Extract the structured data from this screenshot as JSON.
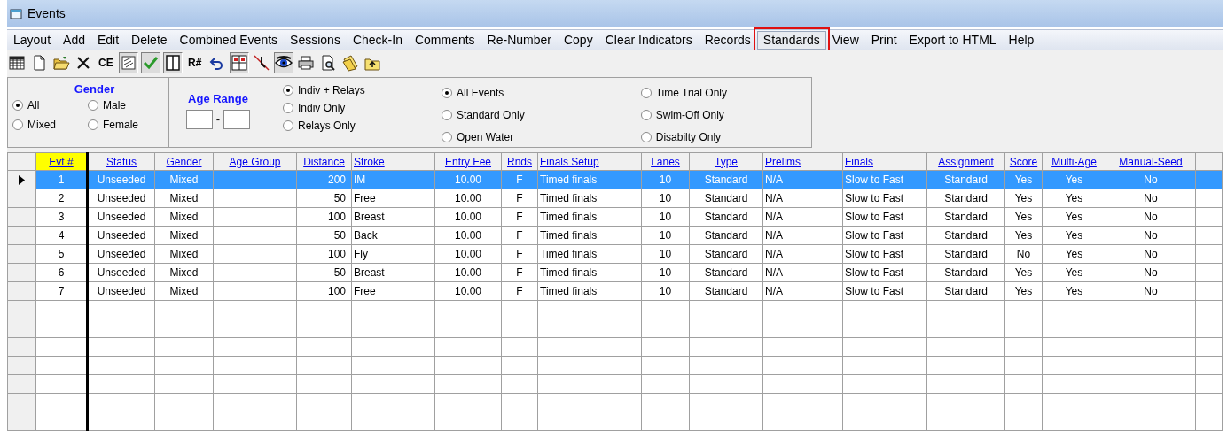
{
  "window": {
    "title": "Events"
  },
  "menu": [
    {
      "label": "Layout",
      "highlighted": false
    },
    {
      "label": "Add",
      "highlighted": false
    },
    {
      "label": "Edit",
      "highlighted": false
    },
    {
      "label": "Delete",
      "highlighted": false
    },
    {
      "label": "Combined Events",
      "highlighted": false
    },
    {
      "label": "Sessions",
      "highlighted": false
    },
    {
      "label": "Check-In",
      "highlighted": false
    },
    {
      "label": "Comments",
      "highlighted": false
    },
    {
      "label": "Re-Number",
      "highlighted": false
    },
    {
      "label": "Copy",
      "highlighted": false
    },
    {
      "label": "Clear Indicators",
      "highlighted": false
    },
    {
      "label": "Records",
      "highlighted": false
    },
    {
      "label": "Standards",
      "highlighted": true
    },
    {
      "label": "View",
      "highlighted": false
    },
    {
      "label": "Print",
      "highlighted": false
    },
    {
      "label": "Export to HTML",
      "highlighted": false
    },
    {
      "label": "Help",
      "highlighted": false
    }
  ],
  "toolbar": [
    {
      "kind": "icon",
      "pressed": false
    },
    {
      "kind": "icon",
      "pressed": false
    },
    {
      "kind": "icon",
      "pressed": false
    },
    {
      "kind": "icon",
      "pressed": false
    },
    {
      "kind": "text",
      "label": "CE",
      "pressed": false
    },
    {
      "kind": "icon",
      "pressed": true
    },
    {
      "kind": "icon",
      "pressed": true
    },
    {
      "kind": "icon",
      "pressed": true
    },
    {
      "kind": "text",
      "label": "R#",
      "pressed": false
    },
    {
      "kind": "icon",
      "pressed": false
    },
    {
      "kind": "icon",
      "pressed": true
    },
    {
      "kind": "icon",
      "pressed": false
    },
    {
      "kind": "icon",
      "pressed": true
    },
    {
      "kind": "icon",
      "pressed": false
    },
    {
      "kind": "icon",
      "pressed": false
    },
    {
      "kind": "icon",
      "pressed": false
    },
    {
      "kind": "icon",
      "pressed": false
    }
  ],
  "gender_filter": {
    "title": "Gender",
    "options": [
      {
        "label": "All",
        "selected": true
      },
      {
        "label": "Male",
        "selected": false
      },
      {
        "label": "Mixed",
        "selected": false
      },
      {
        "label": "Female",
        "selected": false
      }
    ]
  },
  "age_range": {
    "title": "Age Range",
    "separator": "-"
  },
  "entry_filter": {
    "options": [
      {
        "label": "Indiv + Relays",
        "selected": true
      },
      {
        "label": "Indiv Only",
        "selected": false
      },
      {
        "label": "Relays Only",
        "selected": false
      }
    ]
  },
  "event_filter": {
    "options": [
      {
        "label": "All Events",
        "selected": true
      },
      {
        "label": "Standard Only",
        "selected": false
      },
      {
        "label": "Open Water",
        "selected": false
      },
      {
        "label": "Time Trial Only",
        "selected": false
      },
      {
        "label": "Swim-Off Only",
        "selected": false
      },
      {
        "label": "Disabilty Only",
        "selected": false
      }
    ]
  },
  "table": {
    "columns": [
      {
        "label": "Evt #",
        "sorted": true
      },
      {
        "label": "Status",
        "sorted": false
      },
      {
        "label": "Gender",
        "sorted": false
      },
      {
        "label": "Age Group",
        "sorted": false
      },
      {
        "label": "Distance",
        "sorted": false
      },
      {
        "label": "Stroke",
        "sorted": false
      },
      {
        "label": "Entry Fee",
        "sorted": false
      },
      {
        "label": "Rnds",
        "sorted": false
      },
      {
        "label": "Finals Setup",
        "sorted": false
      },
      {
        "label": "Lanes",
        "sorted": false
      },
      {
        "label": "Type",
        "sorted": false
      },
      {
        "label": "Prelims",
        "sorted": false
      },
      {
        "label": "Finals",
        "sorted": false
      },
      {
        "label": "Assignment",
        "sorted": false
      },
      {
        "label": "Score",
        "sorted": false
      },
      {
        "label": "Multi-Age",
        "sorted": false
      },
      {
        "label": "Manual-Seed",
        "sorted": false
      }
    ],
    "rows": [
      {
        "selected": true,
        "cells": [
          "1",
          "Unseeded",
          "Mixed",
          "",
          "200",
          "IM",
          "10.00",
          "F",
          "Timed finals",
          "10",
          "Standard",
          "N/A",
          "Slow to Fast",
          "Standard",
          "Yes",
          "Yes",
          "No"
        ]
      },
      {
        "selected": false,
        "cells": [
          "2",
          "Unseeded",
          "Mixed",
          "",
          "50",
          "Free",
          "10.00",
          "F",
          "Timed finals",
          "10",
          "Standard",
          "N/A",
          "Slow to Fast",
          "Standard",
          "Yes",
          "Yes",
          "No"
        ]
      },
      {
        "selected": false,
        "cells": [
          "3",
          "Unseeded",
          "Mixed",
          "",
          "100",
          "Breast",
          "10.00",
          "F",
          "Timed finals",
          "10",
          "Standard",
          "N/A",
          "Slow to Fast",
          "Standard",
          "Yes",
          "Yes",
          "No"
        ]
      },
      {
        "selected": false,
        "cells": [
          "4",
          "Unseeded",
          "Mixed",
          "",
          "50",
          "Back",
          "10.00",
          "F",
          "Timed finals",
          "10",
          "Standard",
          "N/A",
          "Slow to Fast",
          "Standard",
          "Yes",
          "Yes",
          "No"
        ]
      },
      {
        "selected": false,
        "cells": [
          "5",
          "Unseeded",
          "Mixed",
          "",
          "100",
          "Fly",
          "10.00",
          "F",
          "Timed finals",
          "10",
          "Standard",
          "N/A",
          "Slow to Fast",
          "Standard",
          "No",
          "Yes",
          "No"
        ]
      },
      {
        "selected": false,
        "cells": [
          "6",
          "Unseeded",
          "Mixed",
          "",
          "50",
          "Breast",
          "10.00",
          "F",
          "Timed finals",
          "10",
          "Standard",
          "N/A",
          "Slow to Fast",
          "Standard",
          "Yes",
          "Yes",
          "No"
        ]
      },
      {
        "selected": false,
        "cells": [
          "7",
          "Unseeded",
          "Mixed",
          "",
          "100",
          "Free",
          "10.00",
          "F",
          "Timed finals",
          "10",
          "Standard",
          "N/A",
          "Slow to Fast",
          "Standard",
          "Yes",
          "Yes",
          "No"
        ]
      }
    ]
  }
}
